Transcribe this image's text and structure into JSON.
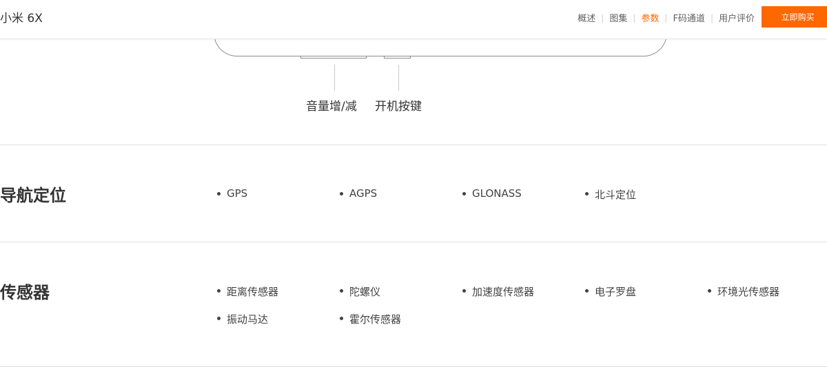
{
  "header": {
    "product_name": "小米 6X",
    "nav": [
      {
        "label": "概述",
        "active": false
      },
      {
        "label": "图集",
        "active": false
      },
      {
        "label": "参数",
        "active": true
      },
      {
        "label": "F码通道",
        "active": false
      },
      {
        "label": "用户评价",
        "active": false
      }
    ],
    "buy_label": "立即购买",
    "accent_color": "#ff6700"
  },
  "hardware": {
    "volume_label": "音量增/减",
    "power_label": "开机按键"
  },
  "sections": {
    "navigation": {
      "title": "导航定位",
      "items": [
        "GPS",
        "AGPS",
        "GLONASS",
        "北斗定位"
      ]
    },
    "sensors": {
      "title": "传感器",
      "items": [
        "距离传感器",
        "陀螺仪",
        "加速度传感器",
        "电子罗盘",
        "环境光传感器",
        "振动马达",
        "霍尔传感器"
      ]
    }
  }
}
